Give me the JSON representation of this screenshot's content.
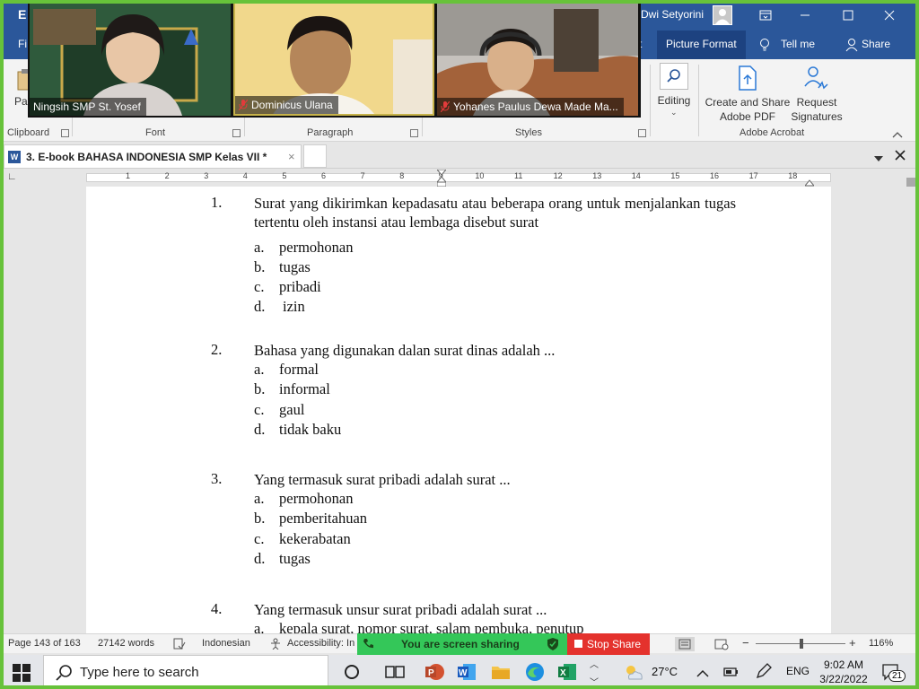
{
  "titlebar": {
    "user_name": "Dwi Setyorini",
    "app_letter": "E"
  },
  "tabs": {
    "file_partial": "Fi",
    "hidden_partial": "t",
    "picture_format": "Picture Format",
    "tell_me": "Tell me",
    "share": "Share"
  },
  "ribbon": {
    "paste_partial": "Pas",
    "clipboard_label": "Clipboard",
    "font_label": "Font",
    "paragraph_label": "Paragraph",
    "styles_label": "Styles",
    "editing_label": "Editing",
    "create_share_pdf_line1": "Create and Share",
    "create_share_pdf_line2": "Adobe PDF",
    "request_sig_line1": "Request",
    "request_sig_line2": "Signatures",
    "adobe_label": "Adobe Acrobat"
  },
  "doc_tab": {
    "title": "3. E-book BAHASA INDONESIA SMP Kelas VII *",
    "close": "×"
  },
  "ruler": {
    "numbers": [
      "1",
      "2",
      "3",
      "4",
      "5",
      "6",
      "7",
      "8",
      "9",
      "10",
      "11",
      "12",
      "13",
      "14",
      "15",
      "16",
      "17",
      "18"
    ]
  },
  "document": {
    "questions": [
      {
        "number": "1.",
        "text": "Surat yang dikirimkan kepadasatu atau beberapa orang untuk menjalankan tugas tertentu oleh instansi atau lembaga disebut surat",
        "options": [
          {
            "letter": "a.",
            "text": "permohonan"
          },
          {
            "letter": "b.",
            "text": "tugas"
          },
          {
            "letter": "c.",
            "text": "pribadi"
          },
          {
            "letter": "d.",
            "text": " izin"
          }
        ]
      },
      {
        "number": "2.",
        "text": "Bahasa yang digunakan dalan surat dinas adalah ...",
        "options": [
          {
            "letter": "a.",
            "text": "formal"
          },
          {
            "letter": "b.",
            "text": "informal"
          },
          {
            "letter": "c.",
            "text": "gaul"
          },
          {
            "letter": "d.",
            "text": "tidak baku"
          }
        ]
      },
      {
        "number": "3.",
        "text": "Yang termasuk surat pribadi adalah surat ...",
        "options": [
          {
            "letter": "a.",
            "text": "permohonan"
          },
          {
            "letter": "b.",
            "text": "pemberitahuan"
          },
          {
            "letter": "c.",
            "text": "kekerabatan"
          },
          {
            "letter": "d.",
            "text": "tugas"
          }
        ]
      },
      {
        "number": "4.",
        "text": "Yang termasuk unsur surat pribadi adalah surat ...",
        "options": [
          {
            "letter": "a.",
            "text": "kepala surat, nomor surat, salam pembuka, penutup"
          }
        ]
      }
    ]
  },
  "statusbar": {
    "page": "Page 143 of 163",
    "words": "27142 words",
    "language": "Indonesian",
    "accessibility": "Accessibility: In",
    "zoom": "116%"
  },
  "share_bar": {
    "sharing_text": "You are screen sharing",
    "stop_text": "Stop Share"
  },
  "taskbar": {
    "search_placeholder": "Type here to search",
    "temperature": "27°C",
    "language": "ENG",
    "time": "9:02 AM",
    "date": "3/22/2022",
    "notifications": "21"
  },
  "video": {
    "participants": [
      {
        "name": "Ningsih SMP St. Yosef",
        "muted": false
      },
      {
        "name": "Dominicus Ulana",
        "muted": true
      },
      {
        "name": "Yohanes Paulus Dewa Made Ma...",
        "muted": true
      }
    ]
  },
  "colors": {
    "word_blue": "#2b579a",
    "share_green": "#34c759",
    "stop_red": "#e4322d",
    "border_green": "#67c23a"
  }
}
